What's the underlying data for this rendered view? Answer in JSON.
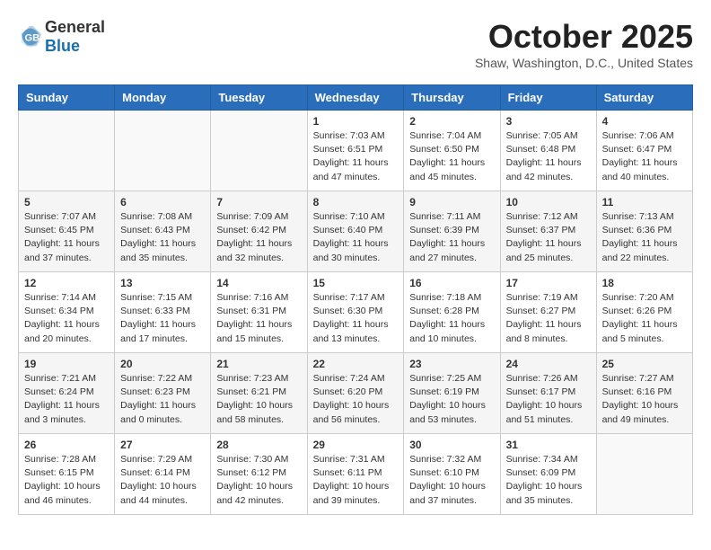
{
  "header": {
    "logo_general": "General",
    "logo_blue": "Blue",
    "month_title": "October 2025",
    "location": "Shaw, Washington, D.C., United States"
  },
  "weekdays": [
    "Sunday",
    "Monday",
    "Tuesday",
    "Wednesday",
    "Thursday",
    "Friday",
    "Saturday"
  ],
  "weeks": [
    [
      {
        "day": "",
        "info": ""
      },
      {
        "day": "",
        "info": ""
      },
      {
        "day": "",
        "info": ""
      },
      {
        "day": "1",
        "info": "Sunrise: 7:03 AM\nSunset: 6:51 PM\nDaylight: 11 hours\nand 47 minutes."
      },
      {
        "day": "2",
        "info": "Sunrise: 7:04 AM\nSunset: 6:50 PM\nDaylight: 11 hours\nand 45 minutes."
      },
      {
        "day": "3",
        "info": "Sunrise: 7:05 AM\nSunset: 6:48 PM\nDaylight: 11 hours\nand 42 minutes."
      },
      {
        "day": "4",
        "info": "Sunrise: 7:06 AM\nSunset: 6:47 PM\nDaylight: 11 hours\nand 40 minutes."
      }
    ],
    [
      {
        "day": "5",
        "info": "Sunrise: 7:07 AM\nSunset: 6:45 PM\nDaylight: 11 hours\nand 37 minutes."
      },
      {
        "day": "6",
        "info": "Sunrise: 7:08 AM\nSunset: 6:43 PM\nDaylight: 11 hours\nand 35 minutes."
      },
      {
        "day": "7",
        "info": "Sunrise: 7:09 AM\nSunset: 6:42 PM\nDaylight: 11 hours\nand 32 minutes."
      },
      {
        "day": "8",
        "info": "Sunrise: 7:10 AM\nSunset: 6:40 PM\nDaylight: 11 hours\nand 30 minutes."
      },
      {
        "day": "9",
        "info": "Sunrise: 7:11 AM\nSunset: 6:39 PM\nDaylight: 11 hours\nand 27 minutes."
      },
      {
        "day": "10",
        "info": "Sunrise: 7:12 AM\nSunset: 6:37 PM\nDaylight: 11 hours\nand 25 minutes."
      },
      {
        "day": "11",
        "info": "Sunrise: 7:13 AM\nSunset: 6:36 PM\nDaylight: 11 hours\nand 22 minutes."
      }
    ],
    [
      {
        "day": "12",
        "info": "Sunrise: 7:14 AM\nSunset: 6:34 PM\nDaylight: 11 hours\nand 20 minutes."
      },
      {
        "day": "13",
        "info": "Sunrise: 7:15 AM\nSunset: 6:33 PM\nDaylight: 11 hours\nand 17 minutes."
      },
      {
        "day": "14",
        "info": "Sunrise: 7:16 AM\nSunset: 6:31 PM\nDaylight: 11 hours\nand 15 minutes."
      },
      {
        "day": "15",
        "info": "Sunrise: 7:17 AM\nSunset: 6:30 PM\nDaylight: 11 hours\nand 13 minutes."
      },
      {
        "day": "16",
        "info": "Sunrise: 7:18 AM\nSunset: 6:28 PM\nDaylight: 11 hours\nand 10 minutes."
      },
      {
        "day": "17",
        "info": "Sunrise: 7:19 AM\nSunset: 6:27 PM\nDaylight: 11 hours\nand 8 minutes."
      },
      {
        "day": "18",
        "info": "Sunrise: 7:20 AM\nSunset: 6:26 PM\nDaylight: 11 hours\nand 5 minutes."
      }
    ],
    [
      {
        "day": "19",
        "info": "Sunrise: 7:21 AM\nSunset: 6:24 PM\nDaylight: 11 hours\nand 3 minutes."
      },
      {
        "day": "20",
        "info": "Sunrise: 7:22 AM\nSunset: 6:23 PM\nDaylight: 11 hours\nand 0 minutes."
      },
      {
        "day": "21",
        "info": "Sunrise: 7:23 AM\nSunset: 6:21 PM\nDaylight: 10 hours\nand 58 minutes."
      },
      {
        "day": "22",
        "info": "Sunrise: 7:24 AM\nSunset: 6:20 PM\nDaylight: 10 hours\nand 56 minutes."
      },
      {
        "day": "23",
        "info": "Sunrise: 7:25 AM\nSunset: 6:19 PM\nDaylight: 10 hours\nand 53 minutes."
      },
      {
        "day": "24",
        "info": "Sunrise: 7:26 AM\nSunset: 6:17 PM\nDaylight: 10 hours\nand 51 minutes."
      },
      {
        "day": "25",
        "info": "Sunrise: 7:27 AM\nSunset: 6:16 PM\nDaylight: 10 hours\nand 49 minutes."
      }
    ],
    [
      {
        "day": "26",
        "info": "Sunrise: 7:28 AM\nSunset: 6:15 PM\nDaylight: 10 hours\nand 46 minutes."
      },
      {
        "day": "27",
        "info": "Sunrise: 7:29 AM\nSunset: 6:14 PM\nDaylight: 10 hours\nand 44 minutes."
      },
      {
        "day": "28",
        "info": "Sunrise: 7:30 AM\nSunset: 6:12 PM\nDaylight: 10 hours\nand 42 minutes."
      },
      {
        "day": "29",
        "info": "Sunrise: 7:31 AM\nSunset: 6:11 PM\nDaylight: 10 hours\nand 39 minutes."
      },
      {
        "day": "30",
        "info": "Sunrise: 7:32 AM\nSunset: 6:10 PM\nDaylight: 10 hours\nand 37 minutes."
      },
      {
        "day": "31",
        "info": "Sunrise: 7:34 AM\nSunset: 6:09 PM\nDaylight: 10 hours\nand 35 minutes."
      },
      {
        "day": "",
        "info": ""
      }
    ]
  ]
}
